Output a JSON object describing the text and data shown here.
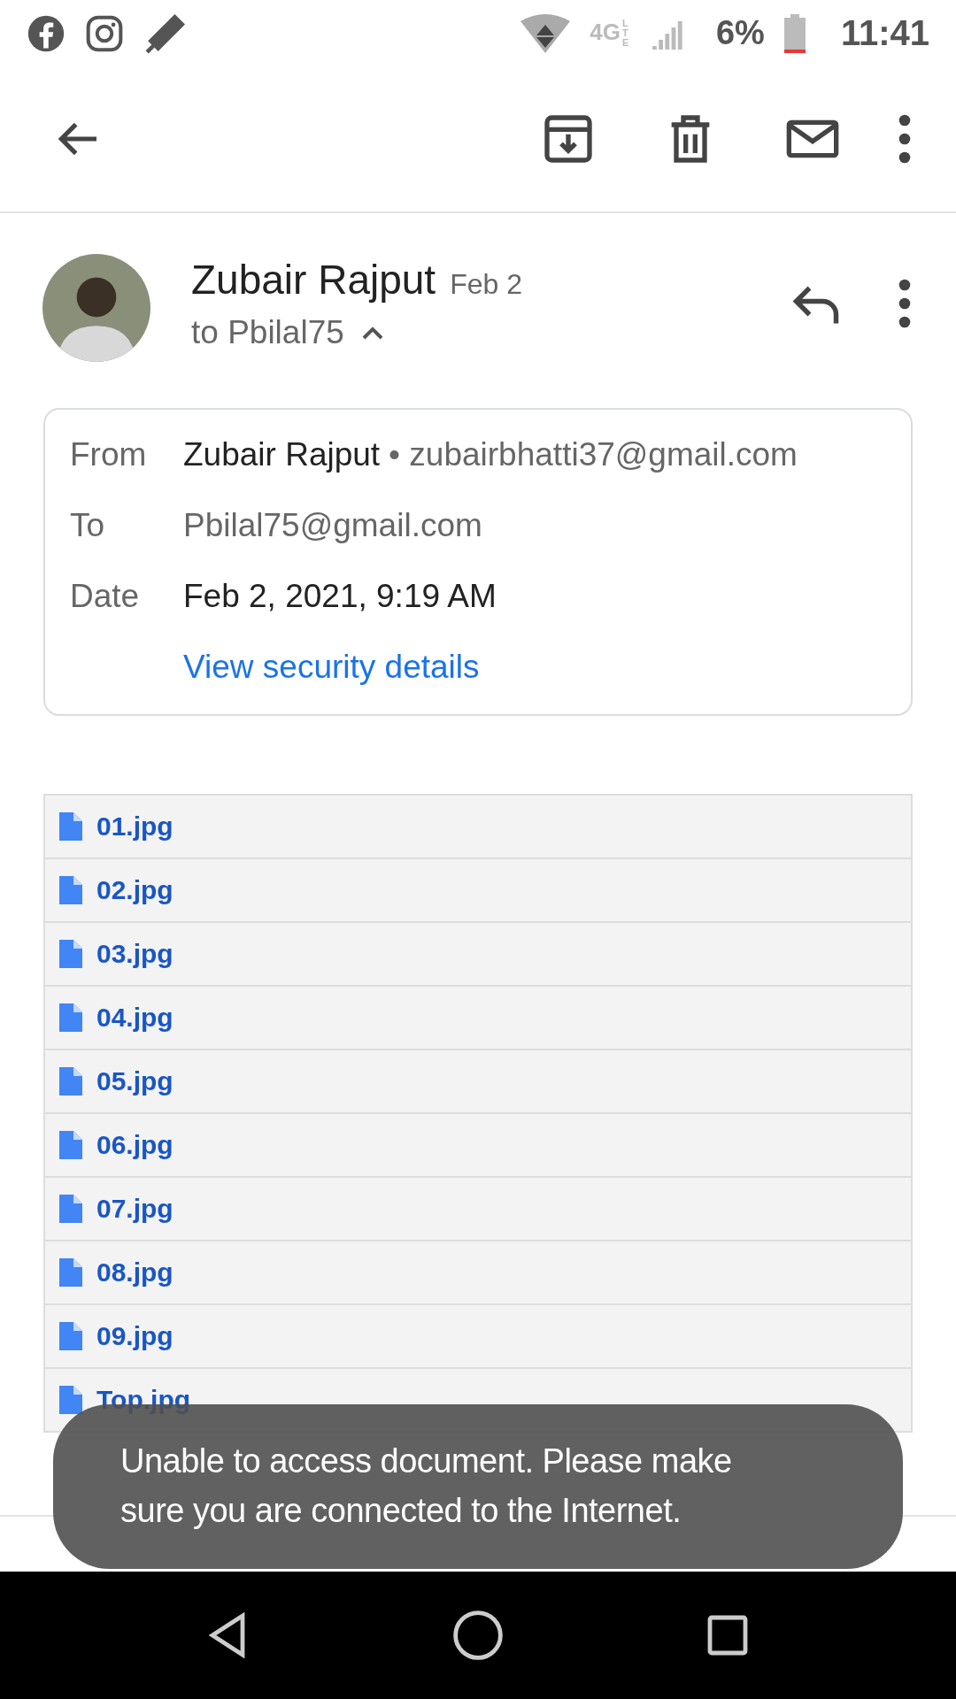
{
  "status_bar": {
    "network": "4G",
    "network_sub": "LTE",
    "battery": "6%",
    "time": "11:41"
  },
  "toolbar": {
    "actions": [
      {
        "kind": "archive"
      },
      {
        "kind": "delete"
      },
      {
        "kind": "mark-unread"
      },
      {
        "kind": "more"
      }
    ]
  },
  "message": {
    "sender": "Zubair Rajput",
    "date": "Feb 2",
    "recipient": "to Pbilal75",
    "details_expanded": true,
    "details": [
      {
        "label": "From",
        "value": "Zubair Rajput",
        "extra": "• zubairbhatti37@gmail.com"
      },
      {
        "label": "To",
        "value": "Pbilal75@gmail.com",
        "muted": true
      },
      {
        "label": "Date",
        "value": "Feb 2, 2021, 9:19 AM"
      }
    ],
    "security_link": "View security details"
  },
  "attachments": [
    "01.jpg",
    "02.jpg",
    "03.jpg",
    "04.jpg",
    "05.jpg",
    "06.jpg",
    "07.jpg",
    "08.jpg",
    "09.jpg",
    "Top.jpg"
  ],
  "toast": "Unable to access document. Please make sure you are connected to the Internet."
}
